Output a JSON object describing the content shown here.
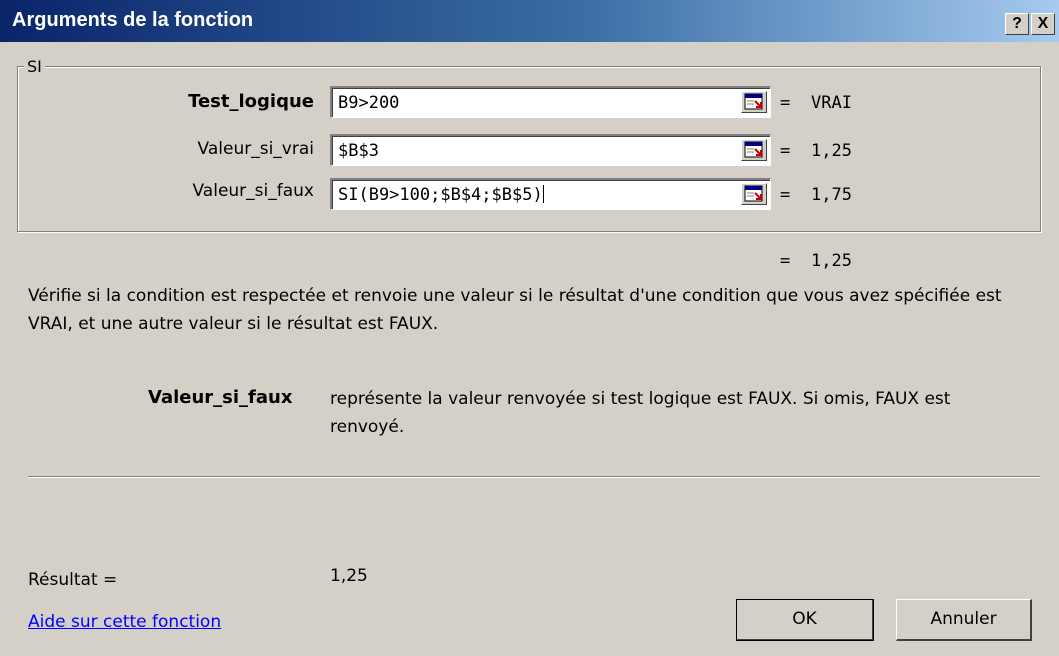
{
  "window": {
    "title": "Arguments de la fonction",
    "help_button": "?",
    "close_button": "X"
  },
  "function_group": {
    "label": "SI",
    "arguments": [
      {
        "name": "Test_logique",
        "value": "B9>200",
        "equals": "=",
        "result": "VRAI"
      },
      {
        "name": "Valeur_si_vrai",
        "value": "$B$3",
        "equals": "=",
        "result": "1,25"
      },
      {
        "name": "Valeur_si_faux",
        "value": "SI(B9>100;$B$4;$B$5)",
        "equals": "=",
        "result": "1,75"
      }
    ]
  },
  "formula_result": {
    "equals": "=",
    "value": "1,25"
  },
  "description": "Vérifie si la condition est respectée et renvoie une valeur si le résultat d'une condition que vous avez spécifiée est VRAI, et une autre valeur si le résultat est FAUX.",
  "argument_help": {
    "name": "Valeur_si_faux",
    "text": "représente la valeur renvoyée si test logique est FAUX. Si omis, FAUX est renvoyé."
  },
  "result": {
    "label": "Résultat =",
    "value": "1,25"
  },
  "help_link": "Aide sur cette fonction",
  "buttons": {
    "ok": "OK",
    "cancel": "Annuler"
  },
  "colors": {
    "title_start": "#0a246a",
    "title_end": "#a6caf0",
    "dialog_bg": "#d4d0c8",
    "link": "#0000ff"
  },
  "icons": {
    "range_selector": "collapse-dialog-icon"
  }
}
